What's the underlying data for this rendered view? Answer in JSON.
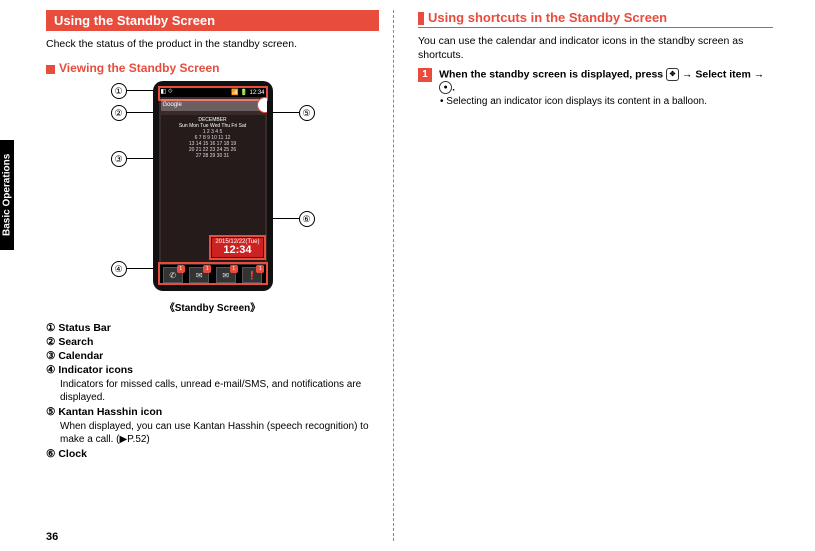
{
  "sideTab": "Basic Operations",
  "pageNumber": "36",
  "left": {
    "titleBar": "Using the Standby Screen",
    "intro": "Check the status of the product in the standby screen.",
    "viewingHead": "Viewing the Standby Screen",
    "caption": "《Standby Screen》",
    "phone": {
      "statusTime": "12:34",
      "searchLabel": "Google",
      "calMonth": "DECEMBER",
      "calDays": "Sun Mon Tue Wed Thu Fri Sat",
      "calRow1": "  1  2  3  4  5",
      "calRow2": "6  7  8  9 10 11 12",
      "calRow3": "13 14 15 16 17 18 19",
      "calRow4": "20 21 22 23 24 25 26",
      "calRow5": "27 28 29 30 31",
      "clockDate": "2015/12/22(Tue)",
      "clockTime": "12:34",
      "indBadge": "1"
    },
    "legend": {
      "i1": "① Status Bar",
      "i2": "② Search",
      "i3": "③ Calendar",
      "i4": "④ Indicator icons",
      "i4sub": "Indicators for missed calls, unread e-mail/SMS, and notifications are displayed.",
      "i5": "⑤ Kantan Hasshin icon",
      "i5sub": "When displayed, you can use Kantan Hasshin (speech recognition) to make a call. (▶P.52)",
      "i6": "⑥ Clock"
    }
  },
  "right": {
    "titleRed": "Using shortcuts in the Standby Screen",
    "intro": "You can use the calendar and indicator icons in the standby screen as shortcuts.",
    "step1num": "1",
    "step1a": "When the standby screen is displayed, press ",
    "step1b": " → Select item → ",
    "step1c": ".",
    "step1bullet": "• Selecting an indicator icon displays its content in a balloon."
  }
}
